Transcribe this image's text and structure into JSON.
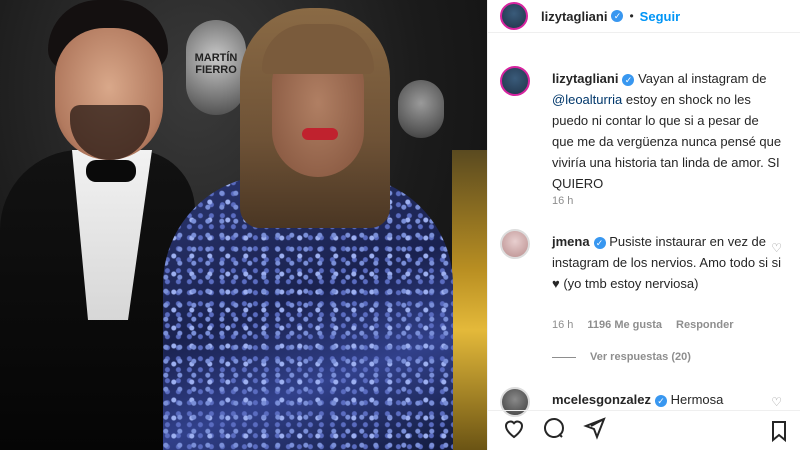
{
  "header": {
    "username": "lizytagliani",
    "dot": "•",
    "follow_label": "Seguir"
  },
  "photo": {
    "badge_text": "MARTÍN FIERRO"
  },
  "caption": {
    "username": "lizytagliani",
    "text_before": "Vayan al instagram de ",
    "mention": "@leoalturria",
    "text_after": " estoy en shock no les puedo ni contar lo que si a pesar de que me da vergüenza nunca pensé que viviría una historia tan linda de amor. SI QUIERO",
    "time": "16 h"
  },
  "comments": [
    {
      "username": "jmena",
      "text": "Pusiste instaurar en vez de instagram de los nervios. Amo todo si si ♥ (yo tmb estoy nerviosa)",
      "time": "16 h",
      "likes": "1196 Me gusta",
      "reply_label": "Responder",
      "view_replies": "Ver respuestas (20)"
    },
    {
      "username": "mcelesgonzalez",
      "text": "Hermosa"
    }
  ],
  "icons": {
    "like": "heart-icon",
    "comment": "comment-icon",
    "share": "share-icon",
    "save": "bookmark-icon",
    "more": "more-icon"
  },
  "colors": {
    "accent": "#0095f6",
    "verified": "#3897f0",
    "text": "#262626",
    "muted": "#8e8e8e"
  }
}
